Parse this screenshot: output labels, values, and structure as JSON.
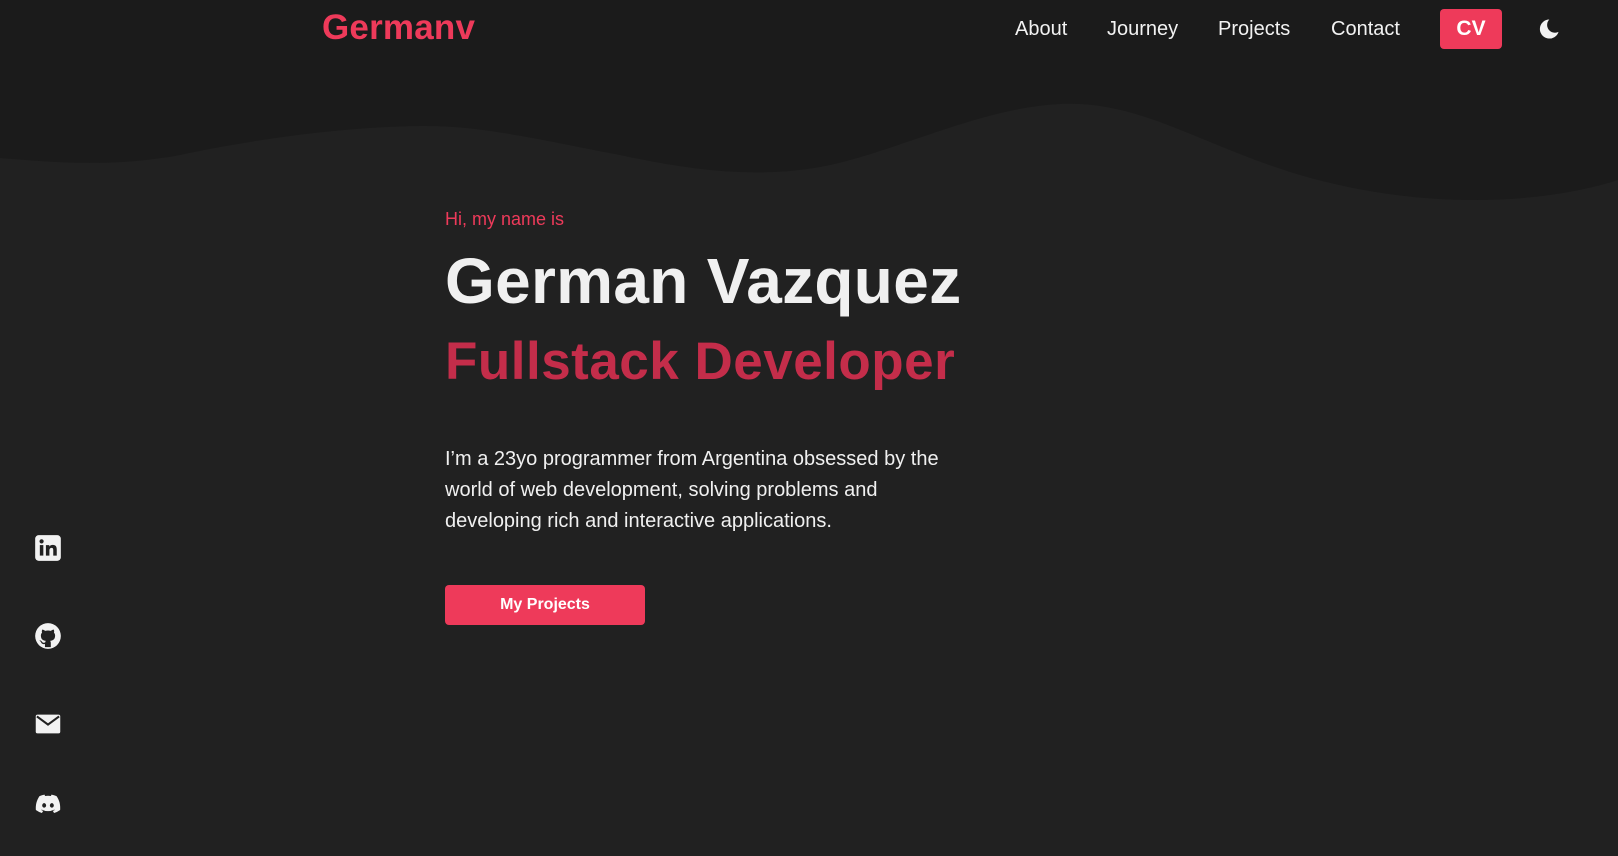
{
  "navbar": {
    "logo": "Germanv",
    "links": [
      {
        "label": "About"
      },
      {
        "label": "Journey"
      },
      {
        "label": "Projects"
      },
      {
        "label": "Contact"
      }
    ],
    "cv_label": "CV",
    "theme_icon": "moon-icon"
  },
  "hero": {
    "greeting": "Hi, my name is",
    "name": "German Vazquez",
    "role": "Fullstack Developer",
    "bio": "I’m a 23yo programmer from Argentina obsessed by the world of web development, solving problems and developing rich and interactive applications.",
    "cta_label": "My Projects"
  },
  "socials": [
    {
      "icon": "linkedin-icon"
    },
    {
      "icon": "github-icon"
    },
    {
      "icon": "email-icon"
    },
    {
      "icon": "discord-icon"
    }
  ],
  "colors": {
    "accent": "#ee3a5a",
    "role_text": "#c42d4a",
    "background": "#212121",
    "header_band": "#1b1b1b",
    "text": "#f0f0f0"
  }
}
